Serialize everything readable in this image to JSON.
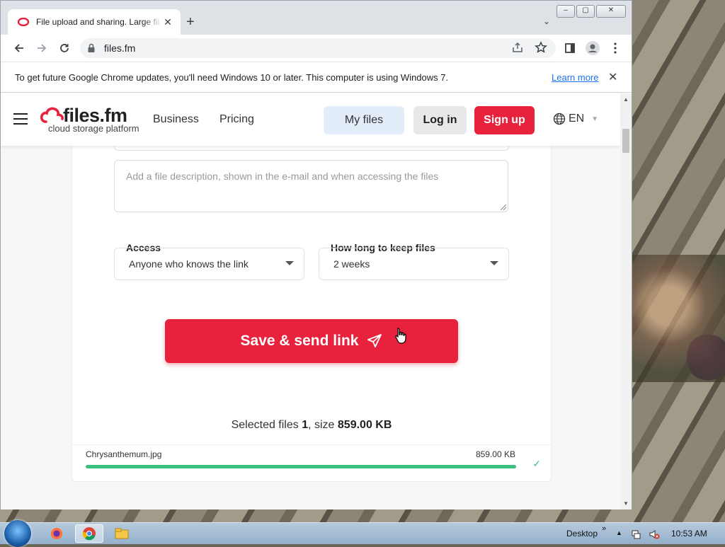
{
  "browser": {
    "tab_title": "File upload and sharing. Large fil",
    "url": "files.fm",
    "infobar_message": "To get future Google Chrome updates, you'll need Windows 10 or later. This computer is using Windows 7.",
    "infobar_link": "Learn more"
  },
  "site": {
    "logo_name": "files.fm",
    "logo_tagline": "cloud storage platform",
    "nav": {
      "business": "Business",
      "pricing": "Pricing"
    },
    "my_files": "My files",
    "log_in": "Log in",
    "sign_up": "Sign up",
    "language": "EN",
    "accent_color": "#e8213c"
  },
  "form": {
    "description_placeholder": "Add a file description, shown in the e-mail and when accessing the files",
    "access_label": "Access",
    "access_value": "Anyone who knows the link",
    "keep_label": "How long to keep files",
    "keep_value": "2 weeks",
    "save_button": "Save & send link"
  },
  "summary": {
    "prefix": "Selected files ",
    "count": "1",
    "mid": ", size ",
    "size": "859.00 KB"
  },
  "files": [
    {
      "name": "Chrysanthemum.jpg",
      "size": "859.00 KB",
      "progress_percent": 100
    }
  ],
  "taskbar": {
    "desktop_label": "Desktop",
    "time": "10:53 AM"
  }
}
